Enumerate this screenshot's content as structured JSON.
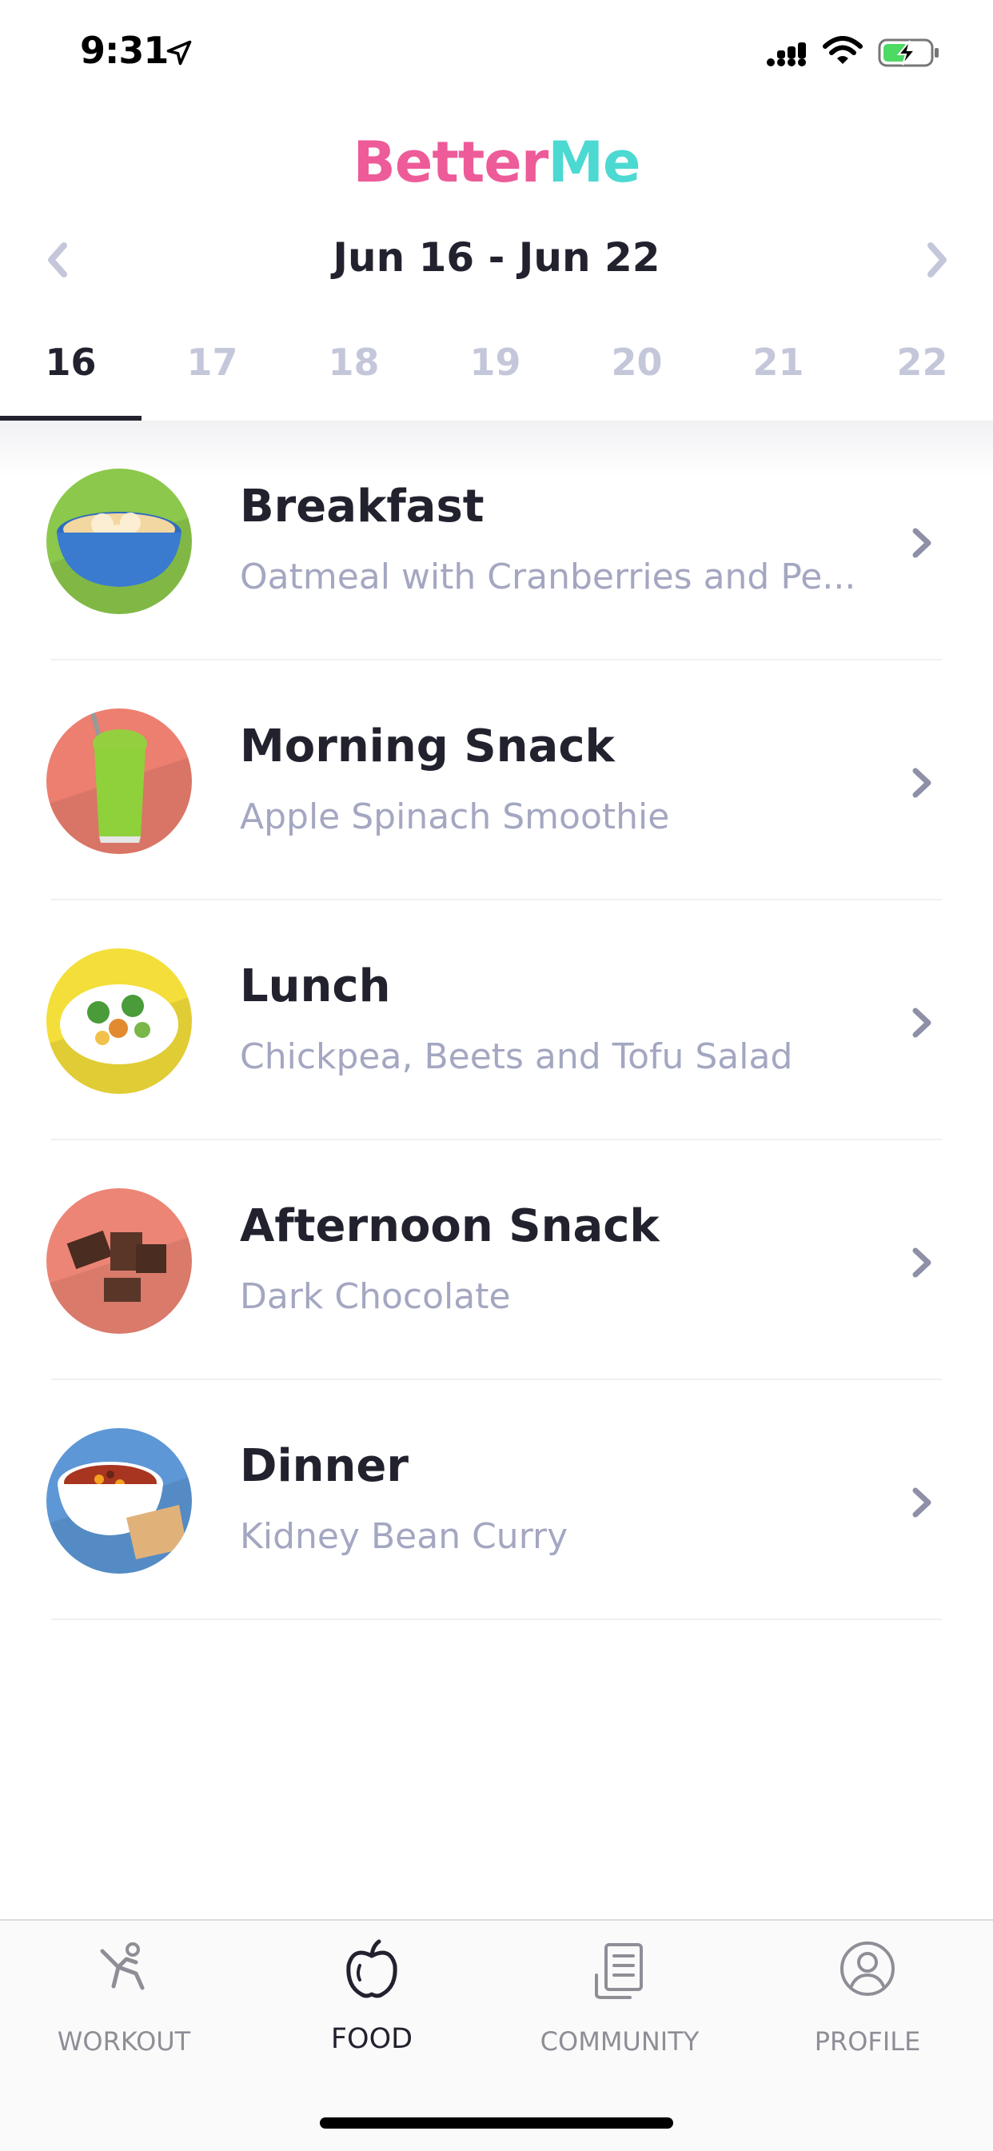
{
  "status_bar": {
    "time": "9:31"
  },
  "app": {
    "logo_part1": "Better",
    "logo_part2": "Me"
  },
  "week": {
    "title": "Jun 16 - Jun 22"
  },
  "days": [
    "16",
    "17",
    "18",
    "19",
    "20",
    "21",
    "22"
  ],
  "selected_day": "16",
  "meals": [
    {
      "name": "Breakfast",
      "description": "Oatmeal with Cranberries and Pe...",
      "thumb_color": "#8cc84b"
    },
    {
      "name": "Morning Snack",
      "description": "Apple Spinach Smoothie",
      "thumb_color": "#ec7f6f"
    },
    {
      "name": "Lunch",
      "description": "Chickpea, Beets and Tofu Salad",
      "thumb_color": "#f4de3a"
    },
    {
      "name": "Afternoon Snack",
      "description": "Dark Chocolate",
      "thumb_color": "#ec8575"
    },
    {
      "name": "Dinner",
      "description": "Kidney Bean Curry",
      "thumb_color": "#5d97d6"
    }
  ],
  "tabs": [
    {
      "label": "WORKOUT",
      "icon": "workout-icon"
    },
    {
      "label": "FOOD",
      "icon": "apple-icon"
    },
    {
      "label": "COMMUNITY",
      "icon": "community-icon"
    },
    {
      "label": "PROFILE",
      "icon": "profile-icon"
    }
  ],
  "active_tab": "FOOD",
  "colors": {
    "brand_pink": "#ee5b99",
    "brand_teal": "#4cd9d2",
    "text_dark": "#22222f",
    "text_muted": "#a4a7c1"
  }
}
